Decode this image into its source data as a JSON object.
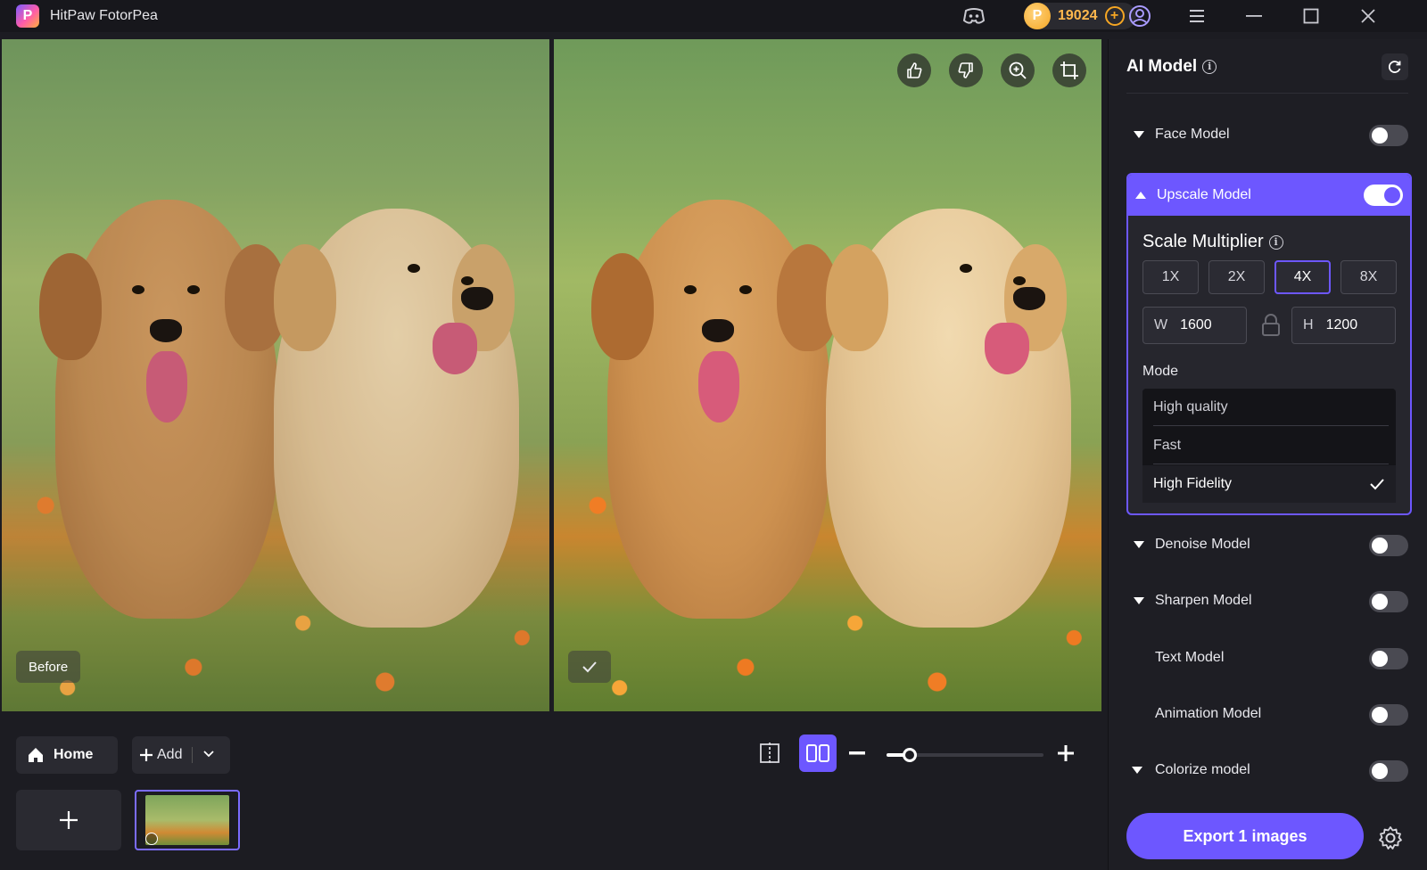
{
  "app": {
    "title": "HitPaw FotorPea",
    "logo_letter": "P"
  },
  "titlebar": {
    "coins": "19024",
    "coin_letter": "P"
  },
  "preview": {
    "before_label": "Before"
  },
  "bottombar": {
    "home_label": "Home",
    "add_label": "Add"
  },
  "panel": {
    "title": "AI Model",
    "models": {
      "face": "Face Model",
      "upscale": "Upscale Model",
      "denoise": "Denoise Model",
      "sharpen": "Sharpen Model",
      "text": "Text Model",
      "animation": "Animation Model",
      "colorize": "Colorize model"
    },
    "upscale": {
      "scale_title": "Scale Multiplier",
      "scales": [
        "1X",
        "2X",
        "4X",
        "8X"
      ],
      "selected_scale": "4X",
      "width_key": "W",
      "width": "1600",
      "height_key": "H",
      "height": "1200",
      "mode_label": "Mode",
      "modes": [
        "High quality",
        "Fast",
        "High Fidelity"
      ],
      "selected_mode": "High Fidelity"
    },
    "export_label": "Export 1 images"
  },
  "colors": {
    "accent": "#6d57ff",
    "coin": "#f5a623",
    "bg": "#1c1c22"
  }
}
